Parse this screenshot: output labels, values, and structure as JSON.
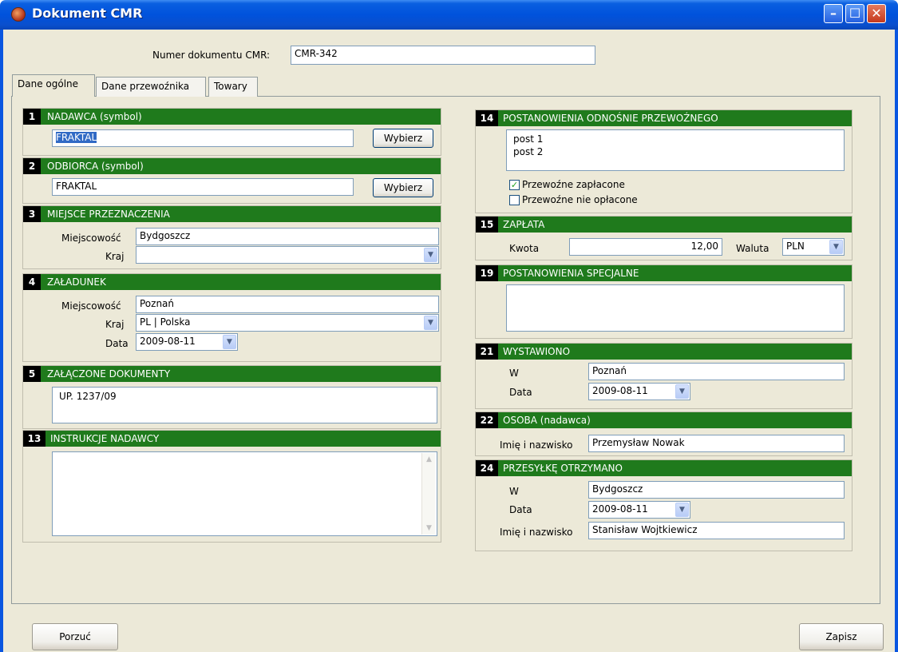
{
  "window": {
    "title": "Dokument CMR"
  },
  "doc_number": {
    "label": "Numer dokumentu CMR:",
    "value": "CMR-342"
  },
  "tabs": [
    {
      "label": "Dane ogólne"
    },
    {
      "label": "Dane przewoźnika"
    },
    {
      "label": "Towary"
    }
  ],
  "s1": {
    "num": "1",
    "title": "NADAWCA (symbol)",
    "value": "FRAKTAL",
    "button": "Wybierz"
  },
  "s2": {
    "num": "2",
    "title": "ODBIORCA (symbol)",
    "value": "FRAKTAL",
    "button": "Wybierz"
  },
  "s3": {
    "num": "3",
    "title": "MIEJSCE PRZEZNACZENIA",
    "city_label": "Miejscowość",
    "city": "Bydgoszcz",
    "country_label": "Kraj",
    "country": ""
  },
  "s4": {
    "num": "4",
    "title": "ZAŁADUNEK",
    "city_label": "Miejscowość",
    "city": "Poznań",
    "country_label": "Kraj",
    "country": "PL | Polska",
    "date_label": "Data",
    "date": "2009-08-11"
  },
  "s5": {
    "num": "5",
    "title": "ZAŁĄCZONE DOKUMENTY",
    "value": "UP. 1237/09"
  },
  "s13": {
    "num": "13",
    "title": "INSTRUKCJE NADAWCY",
    "value": ""
  },
  "s14": {
    "num": "14",
    "title": "POSTANOWIENIA ODNOŚNIE PRZEWOŹNEGO",
    "value": "post 1\npost 2",
    "paid_label": "Przewoźne zapłacone",
    "paid_checked": true,
    "unpaid_label": "Przewoźne nie opłacone",
    "unpaid_checked": false
  },
  "s15": {
    "num": "15",
    "title": "ZAPŁATA",
    "amount_label": "Kwota",
    "amount": "12,00",
    "currency_label": "Waluta",
    "currency": "PLN"
  },
  "s19": {
    "num": "19",
    "title": "POSTANOWIENIA SPECJALNE",
    "value": ""
  },
  "s21": {
    "num": "21",
    "title": "WYSTAWIONO",
    "place_label": "W",
    "place": "Poznań",
    "date_label": "Data",
    "date": "2009-08-11"
  },
  "s22": {
    "num": "22",
    "title": "OSOBA (nadawca)",
    "name_label": "Imię i nazwisko",
    "name": "Przemysław Nowak"
  },
  "s24": {
    "num": "24",
    "title": "PRZESYŁKĘ OTRZYMANO",
    "place_label": "W",
    "place": "Bydgoszcz",
    "date_label": "Data",
    "date": "2009-08-11",
    "name_label": "Imię i nazwisko",
    "name": "Stanisław Wojtkiewicz"
  },
  "footer": {
    "cancel": "Porzuć",
    "save": "Zapisz"
  },
  "colors": {
    "section_header": "#1f7a1c",
    "titlebar": "#0052dc",
    "window_bg": "#ece9d8"
  }
}
